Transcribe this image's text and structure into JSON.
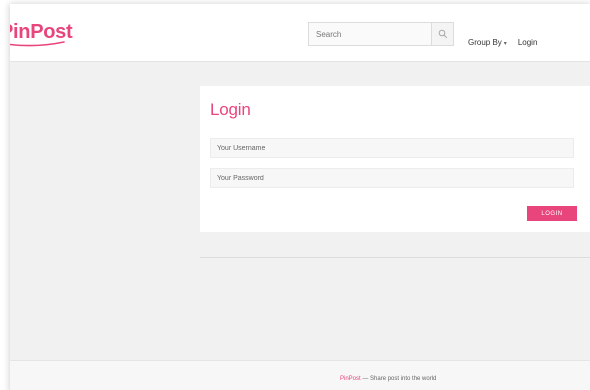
{
  "brand": {
    "name": "PinPost",
    "color": "#e8457c"
  },
  "header": {
    "search": {
      "placeholder": "Search",
      "icon": "search-icon"
    },
    "nav": [
      {
        "label": "Group By",
        "has_dropdown": true,
        "icon": "chevron-down-icon"
      },
      {
        "label": "Login"
      }
    ]
  },
  "login_form": {
    "title": "Login",
    "username_placeholder": "Your Username",
    "password_placeholder": "Your Password",
    "submit_label": "LOGIN"
  },
  "footer": {
    "brand": "PinPost",
    "tagline": " — Share post into the world"
  }
}
